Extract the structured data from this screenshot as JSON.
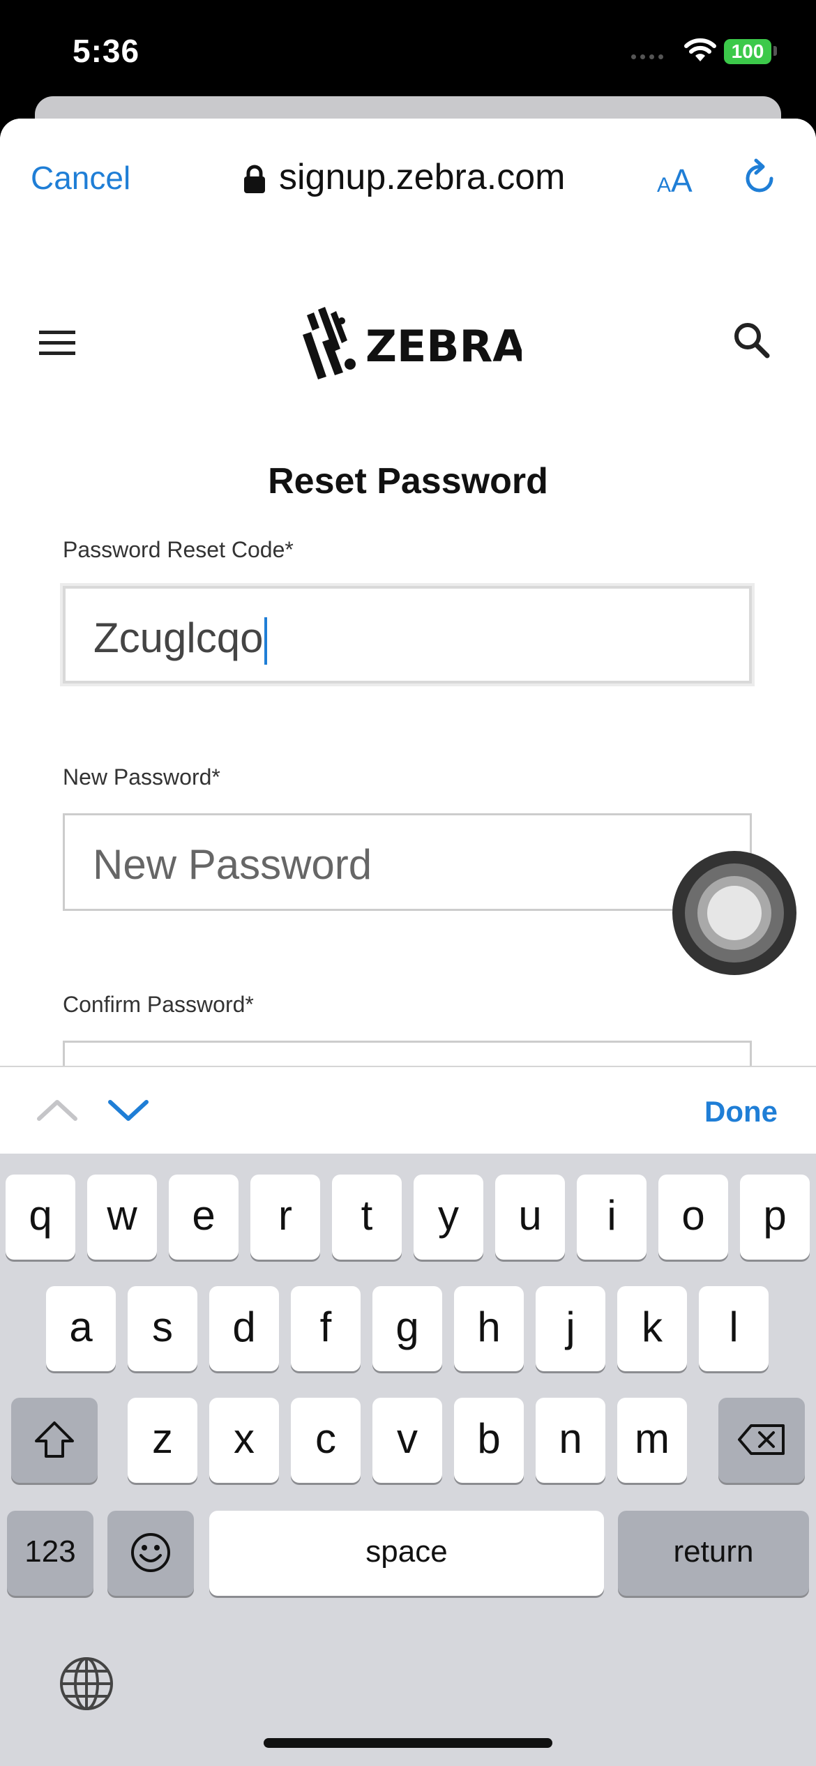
{
  "status_bar": {
    "time": "5:36",
    "battery": "100"
  },
  "browser_bar": {
    "cancel_label": "Cancel",
    "url": "signup.zebra.com",
    "text_size_label_small": "A",
    "text_size_label_large": "A"
  },
  "site_header": {
    "logo_text": "ZEBRA"
  },
  "form": {
    "title": "Reset Password",
    "reset_code": {
      "label": "Password Reset Code*",
      "value": "Zcuglcqo"
    },
    "new_password": {
      "label": "New Password*",
      "placeholder": "New Password"
    },
    "confirm_password": {
      "label": "Confirm Password*"
    }
  },
  "accessory_bar": {
    "done_label": "Done"
  },
  "keyboard": {
    "row1": [
      "q",
      "w",
      "e",
      "r",
      "t",
      "y",
      "u",
      "i",
      "o",
      "p"
    ],
    "row2": [
      "a",
      "s",
      "d",
      "f",
      "g",
      "h",
      "j",
      "k",
      "l"
    ],
    "row3": [
      "z",
      "x",
      "c",
      "v",
      "b",
      "n",
      "m"
    ],
    "numbers_label": "123",
    "space_label": "space",
    "return_label": "return"
  },
  "colors": {
    "accent": "#1f7ed6",
    "battery": "#3cc94a"
  }
}
